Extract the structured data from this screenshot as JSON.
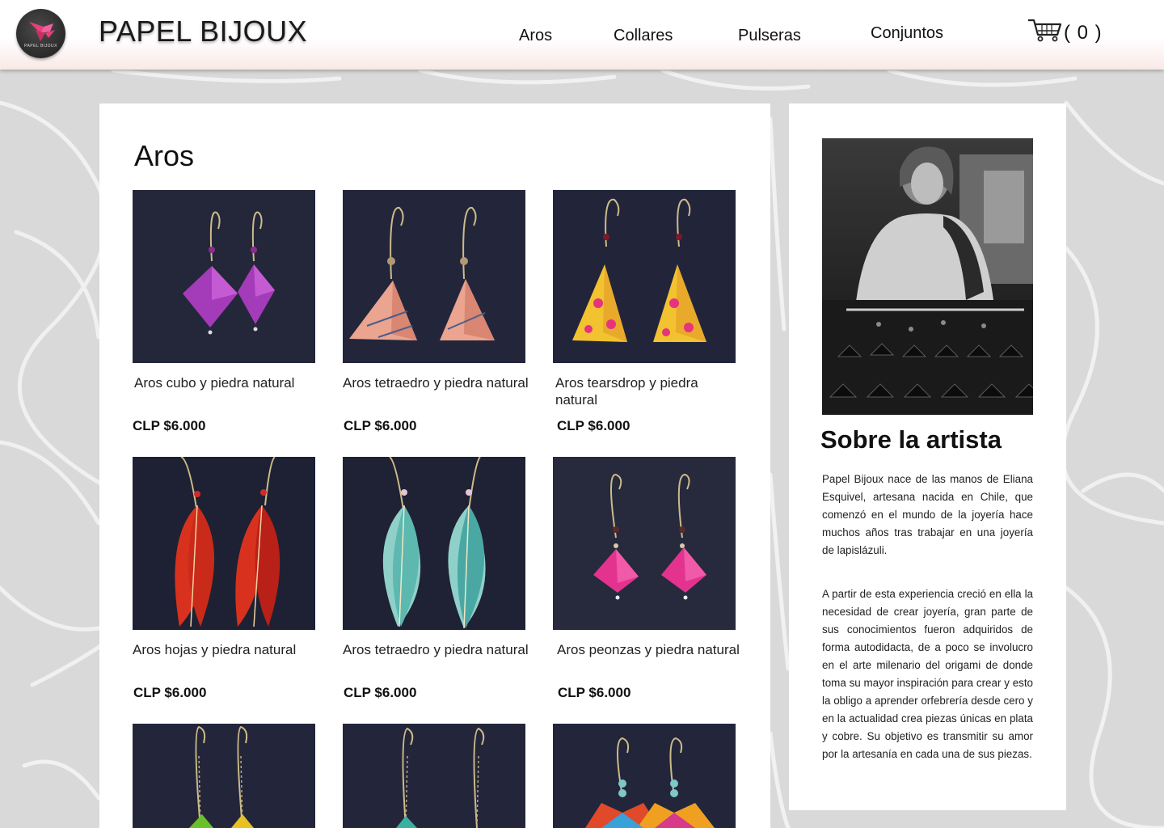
{
  "header": {
    "logo_text": "PAPEL BIJOUX",
    "brand": "PAPEL BIJOUX",
    "nav": [
      "Aros",
      "Collares",
      "Pulseras",
      "Conjuntos"
    ],
    "cart_count": "( 0 )"
  },
  "products": {
    "title": "Aros",
    "items": [
      {
        "name": "Aros cubo y piedra natural",
        "price": "CLP $6.000",
        "icon": "cube-earrings-image"
      },
      {
        "name": "Aros tetraedro y piedra natural",
        "price": "CLP $6.000",
        "icon": "tetrahedron-earrings-image"
      },
      {
        "name": "Aros tearsdrop y piedra natural",
        "price": "CLP $6.000",
        "icon": "teardrop-earrings-image"
      },
      {
        "name": "Aros hojas y piedra natural",
        "price": "CLP $6.000",
        "icon": "leaf-earrings-image"
      },
      {
        "name": "Aros tetraedro y piedra natural",
        "price": "CLP $6.000",
        "icon": "leaf-earrings-image"
      },
      {
        "name": "Aros peonzas y piedra natural",
        "price": "CLP $6.000",
        "icon": "spinning-top-earrings-image"
      }
    ]
  },
  "about": {
    "title": "Sobre la artista",
    "paragraph1": "Papel Bijoux nace de las manos de Eliana Esquivel, artesana nacida en Chile, que comenzó en el mundo de la joyería hace muchos años tras trabajar en una joyería de lapislázuli.",
    "paragraph2": "A partir de esta experiencia creció en ella la necesidad de crear joyería, gran parte de sus conocimientos fueron adquiridos de forma autodidacta, de a poco se involucro en el arte milenario del origami de donde toma su mayor inspiración para crear y esto la obligo a aprender orfebrería desde cero y en la actualidad crea piezas únicas en plata y cobre. Su objetivo es transmitir su amor por la artesanía en cada una de sus piezas."
  },
  "colors": {
    "accent_pink": "#e8407a",
    "header_tint": "#f9e9e6",
    "photo_backdrop": "#24273a"
  }
}
